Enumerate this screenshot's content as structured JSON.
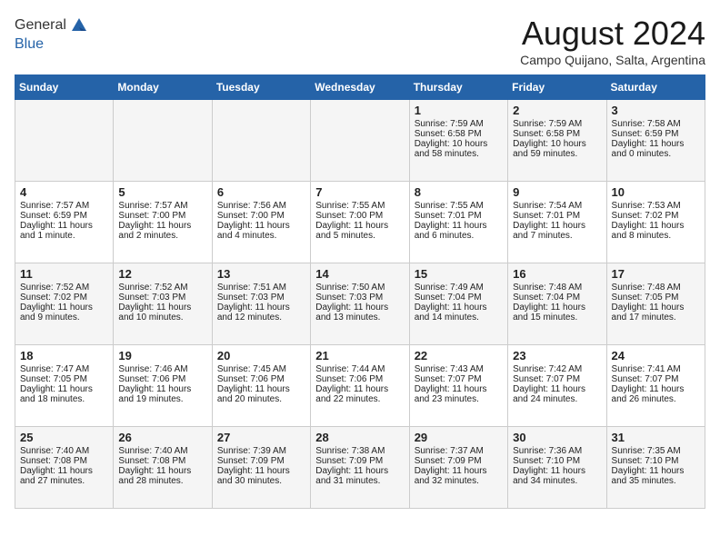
{
  "header": {
    "logo_general": "General",
    "logo_blue": "Blue",
    "month_title": "August 2024",
    "location": "Campo Quijano, Salta, Argentina"
  },
  "weekdays": [
    "Sunday",
    "Monday",
    "Tuesday",
    "Wednesday",
    "Thursday",
    "Friday",
    "Saturday"
  ],
  "weeks": [
    [
      {
        "day": "",
        "content": ""
      },
      {
        "day": "",
        "content": ""
      },
      {
        "day": "",
        "content": ""
      },
      {
        "day": "",
        "content": ""
      },
      {
        "day": "1",
        "content": "Sunrise: 7:59 AM\nSunset: 6:58 PM\nDaylight: 10 hours and 58 minutes."
      },
      {
        "day": "2",
        "content": "Sunrise: 7:59 AM\nSunset: 6:58 PM\nDaylight: 10 hours and 59 minutes."
      },
      {
        "day": "3",
        "content": "Sunrise: 7:58 AM\nSunset: 6:59 PM\nDaylight: 11 hours and 0 minutes."
      }
    ],
    [
      {
        "day": "4",
        "content": "Sunrise: 7:57 AM\nSunset: 6:59 PM\nDaylight: 11 hours and 1 minute."
      },
      {
        "day": "5",
        "content": "Sunrise: 7:57 AM\nSunset: 7:00 PM\nDaylight: 11 hours and 2 minutes."
      },
      {
        "day": "6",
        "content": "Sunrise: 7:56 AM\nSunset: 7:00 PM\nDaylight: 11 hours and 4 minutes."
      },
      {
        "day": "7",
        "content": "Sunrise: 7:55 AM\nSunset: 7:00 PM\nDaylight: 11 hours and 5 minutes."
      },
      {
        "day": "8",
        "content": "Sunrise: 7:55 AM\nSunset: 7:01 PM\nDaylight: 11 hours and 6 minutes."
      },
      {
        "day": "9",
        "content": "Sunrise: 7:54 AM\nSunset: 7:01 PM\nDaylight: 11 hours and 7 minutes."
      },
      {
        "day": "10",
        "content": "Sunrise: 7:53 AM\nSunset: 7:02 PM\nDaylight: 11 hours and 8 minutes."
      }
    ],
    [
      {
        "day": "11",
        "content": "Sunrise: 7:52 AM\nSunset: 7:02 PM\nDaylight: 11 hours and 9 minutes."
      },
      {
        "day": "12",
        "content": "Sunrise: 7:52 AM\nSunset: 7:03 PM\nDaylight: 11 hours and 10 minutes."
      },
      {
        "day": "13",
        "content": "Sunrise: 7:51 AM\nSunset: 7:03 PM\nDaylight: 11 hours and 12 minutes."
      },
      {
        "day": "14",
        "content": "Sunrise: 7:50 AM\nSunset: 7:03 PM\nDaylight: 11 hours and 13 minutes."
      },
      {
        "day": "15",
        "content": "Sunrise: 7:49 AM\nSunset: 7:04 PM\nDaylight: 11 hours and 14 minutes."
      },
      {
        "day": "16",
        "content": "Sunrise: 7:48 AM\nSunset: 7:04 PM\nDaylight: 11 hours and 15 minutes."
      },
      {
        "day": "17",
        "content": "Sunrise: 7:48 AM\nSunset: 7:05 PM\nDaylight: 11 hours and 17 minutes."
      }
    ],
    [
      {
        "day": "18",
        "content": "Sunrise: 7:47 AM\nSunset: 7:05 PM\nDaylight: 11 hours and 18 minutes."
      },
      {
        "day": "19",
        "content": "Sunrise: 7:46 AM\nSunset: 7:06 PM\nDaylight: 11 hours and 19 minutes."
      },
      {
        "day": "20",
        "content": "Sunrise: 7:45 AM\nSunset: 7:06 PM\nDaylight: 11 hours and 20 minutes."
      },
      {
        "day": "21",
        "content": "Sunrise: 7:44 AM\nSunset: 7:06 PM\nDaylight: 11 hours and 22 minutes."
      },
      {
        "day": "22",
        "content": "Sunrise: 7:43 AM\nSunset: 7:07 PM\nDaylight: 11 hours and 23 minutes."
      },
      {
        "day": "23",
        "content": "Sunrise: 7:42 AM\nSunset: 7:07 PM\nDaylight: 11 hours and 24 minutes."
      },
      {
        "day": "24",
        "content": "Sunrise: 7:41 AM\nSunset: 7:07 PM\nDaylight: 11 hours and 26 minutes."
      }
    ],
    [
      {
        "day": "25",
        "content": "Sunrise: 7:40 AM\nSunset: 7:08 PM\nDaylight: 11 hours and 27 minutes."
      },
      {
        "day": "26",
        "content": "Sunrise: 7:40 AM\nSunset: 7:08 PM\nDaylight: 11 hours and 28 minutes."
      },
      {
        "day": "27",
        "content": "Sunrise: 7:39 AM\nSunset: 7:09 PM\nDaylight: 11 hours and 30 minutes."
      },
      {
        "day": "28",
        "content": "Sunrise: 7:38 AM\nSunset: 7:09 PM\nDaylight: 11 hours and 31 minutes."
      },
      {
        "day": "29",
        "content": "Sunrise: 7:37 AM\nSunset: 7:09 PM\nDaylight: 11 hours and 32 minutes."
      },
      {
        "day": "30",
        "content": "Sunrise: 7:36 AM\nSunset: 7:10 PM\nDaylight: 11 hours and 34 minutes."
      },
      {
        "day": "31",
        "content": "Sunrise: 7:35 AM\nSunset: 7:10 PM\nDaylight: 11 hours and 35 minutes."
      }
    ]
  ]
}
